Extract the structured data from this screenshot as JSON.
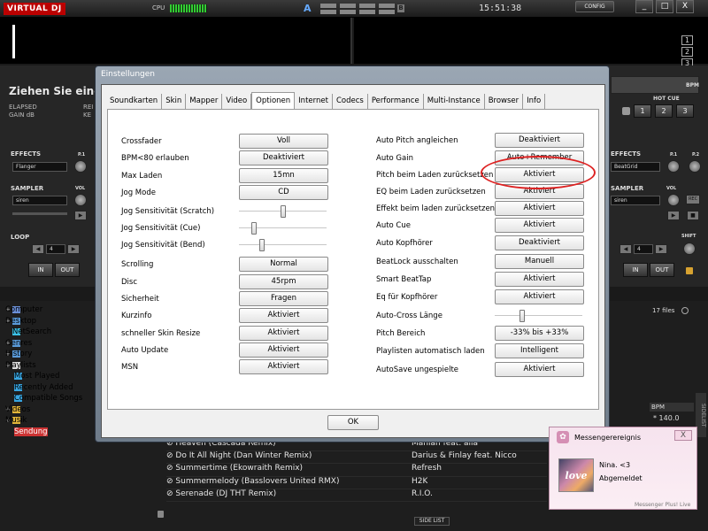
{
  "app": {
    "logo": "VIRTUAL DJ",
    "cpu_label": "CPU",
    "deck_a": "A",
    "deck_b": "B",
    "clock": "15:51:38",
    "config": "CONFIG",
    "win_min": "_",
    "win_max": "□",
    "win_close": "X",
    "deck_numbers": [
      "1",
      "2",
      "3"
    ]
  },
  "deck_left": {
    "title": "Ziehen Sie einen",
    "elapsed": "ELAPSED",
    "gain": "GAIN dB",
    "rem1": "REI",
    "rem2": "KE",
    "effects": "EFFECTS",
    "effect_value": "Flanger",
    "sampler": "SAMPLER",
    "sampler_value": "siren",
    "vol": "VOL",
    "loop": "LOOP",
    "loop_value": "4",
    "in": "IN",
    "out": "OUT",
    "p1": "P.1"
  },
  "deck_right": {
    "bpm": "BPM",
    "hotcue": "HOT CUE",
    "cues": [
      "1",
      "2",
      "3"
    ],
    "effects": "EFFECTS",
    "effect_value": "BeatGrid",
    "sampler": "SAMPLER",
    "sampler_value": "siren",
    "vol": "VOL",
    "loop_value": "4",
    "shift": "SHIFT",
    "in": "IN",
    "out": "OUT",
    "p1": "P.1",
    "p2": "P.2",
    "rec": "REC"
  },
  "browser": {
    "tree": [
      {
        "label": "Computer",
        "color": "#6b8fd6"
      },
      {
        "label": "Desktop",
        "color": "#5a9ad8"
      },
      {
        "label": "NetSearch",
        "color": "#3cc1e6"
      },
      {
        "label": "Genres",
        "color": "#5a9ad8"
      },
      {
        "label": "History",
        "color": "#5a9ad8"
      },
      {
        "label": "Playlists",
        "color": "#ddd"
      },
      {
        "label": "Most Played",
        "color": "#38a5e0"
      },
      {
        "label": "Recently Added",
        "color": "#38a5e0"
      },
      {
        "label": "Compatible Songs",
        "color": "#38a5e0"
      },
      {
        "label": "Videos",
        "color": "#e2b53a"
      },
      {
        "label": "Musik",
        "color": "#e2b53a"
      },
      {
        "label": "Sendung",
        "color": "#d23"
      }
    ],
    "file_count": "17 files",
    "bpm_header": "BPM",
    "bpm_value": "140.0",
    "sidelist_tab": "SIDELIST",
    "sidelist_btn": "SIDE LIST",
    "tracks": [
      {
        "title": "Heaven (Cascada Remix)",
        "artist": "Manian feat. aila"
      },
      {
        "title": "Do It All Night (Dan Winter Remix)",
        "artist": "Darius & Finlay feat. Nicco"
      },
      {
        "title": "Summertime (Ekowraith Remix)",
        "artist": "Refresh"
      },
      {
        "title": "Summermelody (Basslovers United RMX)",
        "artist": "H2K"
      },
      {
        "title": "Serenade (DJ THT Remix)",
        "artist": "R.I.O."
      }
    ]
  },
  "dialog": {
    "title": "Einstellungen",
    "tabs": [
      "Soundkarten",
      "Skin",
      "Mapper",
      "Video",
      "Optionen",
      "Internet",
      "Codecs",
      "Performance",
      "Multi-Instance",
      "Browser",
      "Info"
    ],
    "active_tab": "Optionen",
    "left": [
      {
        "label": "Crossfader",
        "kind": "button",
        "value": "Voll"
      },
      {
        "label": "BPM<80 erlauben",
        "kind": "button",
        "value": "Deaktiviert"
      },
      {
        "label": "Max Laden",
        "kind": "button",
        "value": "15mn"
      },
      {
        "label": "Jog Mode",
        "kind": "button",
        "value": "CD"
      },
      {
        "label": "Jog Sensitivität (Scratch)",
        "kind": "slider",
        "level": 0.5
      },
      {
        "label": "Jog Sensitivität (Cue)",
        "kind": "slider",
        "level": 0.15
      },
      {
        "label": "Jog Sensitivität (Bend)",
        "kind": "slider",
        "level": 0.25
      },
      {
        "label": "Scrolling",
        "kind": "button",
        "value": "Normal"
      },
      {
        "label": "Disc",
        "kind": "button",
        "value": "45rpm"
      },
      {
        "label": "Sicherheit",
        "kind": "button",
        "value": "Fragen"
      },
      {
        "label": "Kurzinfo",
        "kind": "button",
        "value": "Aktiviert"
      },
      {
        "label": "schneller Skin Resize",
        "kind": "button",
        "value": "Aktiviert"
      },
      {
        "label": "Auto Update",
        "kind": "button",
        "value": "Aktiviert"
      },
      {
        "label": "MSN",
        "kind": "button",
        "value": "Aktiviert"
      }
    ],
    "right": [
      {
        "label": "Auto Pitch angleichen",
        "kind": "button",
        "value": "Deaktiviert"
      },
      {
        "label": "Auto Gain",
        "kind": "button",
        "value": "Auto+Remember"
      },
      {
        "label": "Pitch beim Laden zurücksetzen",
        "kind": "button",
        "value": "Aktiviert"
      },
      {
        "label": "EQ beim Laden zurücksetzen",
        "kind": "button",
        "value": "Aktiviert"
      },
      {
        "label": "Effekt beim laden zurücksetzen",
        "kind": "button",
        "value": "Aktiviert"
      },
      {
        "label": "Auto Cue",
        "kind": "button",
        "value": "Aktiviert"
      },
      {
        "label": "Auto Kopfhörer",
        "kind": "button",
        "value": "Deaktiviert"
      },
      {
        "label": "BeatLock ausschalten",
        "kind": "button",
        "value": "Manuell"
      },
      {
        "label": "Smart BeatTap",
        "kind": "button",
        "value": "Aktiviert"
      },
      {
        "label": "Eq für Kopfhörer",
        "kind": "button",
        "value": "Aktiviert"
      },
      {
        "label": "Auto-Cross Länge",
        "kind": "slider",
        "level": 0.3
      },
      {
        "label": "Pitch Bereich",
        "kind": "button",
        "value": "-33% bis +33%"
      },
      {
        "label": "Playlisten automatisch laden",
        "kind": "button",
        "value": "Intelligent"
      },
      {
        "label": "AutoSave ungespielte",
        "kind": "button",
        "value": "Aktiviert"
      }
    ],
    "ok": "OK"
  },
  "toast": {
    "title": "Messengerereignis",
    "name": "Nina. <3",
    "status": "Abgemeldet",
    "footer": "Messenger Plus! Live",
    "close": "X",
    "pic_text": "love"
  }
}
